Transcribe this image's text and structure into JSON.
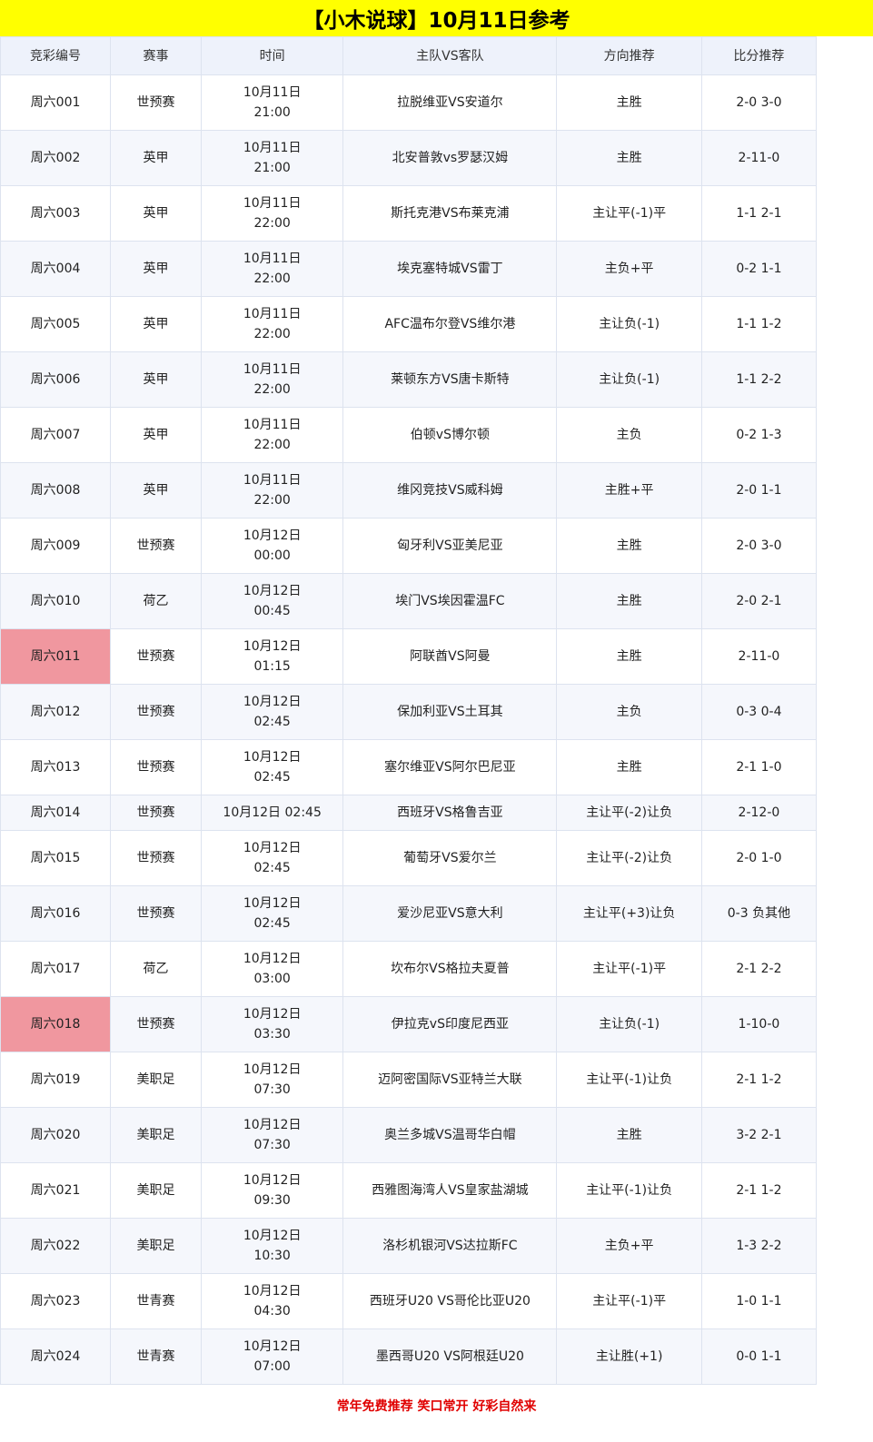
{
  "title": "【小木说球】10月11日参考",
  "columns": [
    "竞彩编号",
    "赛事",
    "时间",
    "主队VS客队",
    "方向推荐",
    "比分推荐"
  ],
  "rows": [
    {
      "id": "周六001",
      "league": "世预赛",
      "date": "10月11日",
      "time": "21:00",
      "match": "拉脱维亚VS安道尔",
      "pick": "主胜",
      "score": "2-0 3-0"
    },
    {
      "id": "周六002",
      "league": "英甲",
      "date": "10月11日",
      "time": "21:00",
      "match": "北安普敦vs罗瑟汉姆",
      "pick": "主胜",
      "score": "2-11-0"
    },
    {
      "id": "周六003",
      "league": "英甲",
      "date": "10月11日",
      "time": "22:00",
      "match": "斯托克港VS布莱克浦",
      "pick": "主让平(-1)平",
      "score": "1-1 2-1"
    },
    {
      "id": "周六004",
      "league": "英甲",
      "date": "10月11日",
      "time": "22:00",
      "match": "埃克塞特城VS雷丁",
      "pick": "主负+平",
      "score": "0-2 1-1"
    },
    {
      "id": "周六005",
      "league": "英甲",
      "date": "10月11日",
      "time": "22:00",
      "match": "AFC温布尔登VS维尔港",
      "pick": "主让负(-1)",
      "score": "1-1 1-2"
    },
    {
      "id": "周六006",
      "league": "英甲",
      "date": "10月11日",
      "time": "22:00",
      "match": "莱顿东方VS唐卡斯特",
      "pick": "主让负(-1)",
      "score": "1-1 2-2"
    },
    {
      "id": "周六007",
      "league": "英甲",
      "date": "10月11日",
      "time": "22:00",
      "match": "伯顿vS博尔顿",
      "pick": "主负",
      "score": "0-2 1-3"
    },
    {
      "id": "周六008",
      "league": "英甲",
      "date": "10月11日",
      "time": "22:00",
      "match": "维冈竞技VS威科姆",
      "pick": "主胜+平",
      "score": "2-0 1-1"
    },
    {
      "id": "周六009",
      "league": "世预赛",
      "date": "10月12日",
      "time": "00:00",
      "match": "匈牙利VS亚美尼亚",
      "pick": "主胜",
      "score": "2-0 3-0"
    },
    {
      "id": "周六010",
      "league": "荷乙",
      "date": "10月12日",
      "time": "00:45",
      "match": "埃门VS埃因霍温FC",
      "pick": "主胜",
      "score": "2-0 2-1"
    },
    {
      "id": "周六011",
      "league": "世预赛",
      "date": "10月12日",
      "time": "01:15",
      "match": "阿联酋VS阿曼",
      "pick": "主胜",
      "score": "2-11-0",
      "highlight": true
    },
    {
      "id": "周六012",
      "league": "世预赛",
      "date": "10月12日",
      "time": "02:45",
      "match": "保加利亚VS土耳其",
      "pick": "主负",
      "score": "0-3 0-4"
    },
    {
      "id": "周六013",
      "league": "世预赛",
      "date": "10月12日",
      "time": "02:45",
      "match": "塞尔维亚VS阿尔巴尼亚",
      "pick": "主胜",
      "score": "2-1 1-0"
    },
    {
      "id": "周六014",
      "league": "世预赛",
      "date": "10月12日 02:45",
      "time": "",
      "match": "西班牙VS格鲁吉亚",
      "pick": "主让平(-2)让负",
      "score": "2-12-0",
      "single": true
    },
    {
      "id": "周六015",
      "league": "世预赛",
      "date": "10月12日",
      "time": "02:45",
      "match": "葡萄牙VS爱尔兰",
      "pick": "主让平(-2)让负",
      "score": "2-0 1-0"
    },
    {
      "id": "周六016",
      "league": "世预赛",
      "date": "10月12日",
      "time": "02:45",
      "match": "爱沙尼亚VS意大利",
      "pick": "主让平(+3)让负",
      "score": "0-3 负其他"
    },
    {
      "id": "周六017",
      "league": "荷乙",
      "date": "10月12日",
      "time": "03:00",
      "match": "坎布尔VS格拉夫夏普",
      "pick": "主让平(-1)平",
      "score": "2-1 2-2"
    },
    {
      "id": "周六018",
      "league": "世预赛",
      "date": "10月12日",
      "time": "03:30",
      "match": "伊拉克vS印度尼西亚",
      "pick": "主让负(-1)",
      "score": "1-10-0",
      "highlight": true
    },
    {
      "id": "周六019",
      "league": "美职足",
      "date": "10月12日",
      "time": "07:30",
      "match": "迈阿密国际VS亚特兰大联",
      "pick": "主让平(-1)让负",
      "score": "2-1 1-2"
    },
    {
      "id": "周六020",
      "league": "美职足",
      "date": "10月12日",
      "time": "07:30",
      "match": "奥兰多城VS温哥华白帽",
      "pick": "主胜",
      "score": "3-2 2-1"
    },
    {
      "id": "周六021",
      "league": "美职足",
      "date": "10月12日",
      "time": "09:30",
      "match": "西雅图海湾人VS皇家盐湖城",
      "pick": "主让平(-1)让负",
      "score": "2-1 1-2"
    },
    {
      "id": "周六022",
      "league": "美职足",
      "date": "10月12日",
      "time": "10:30",
      "match": "洛杉机银河VS达拉斯FC",
      "pick": "主负+平",
      "score": "1-3 2-2"
    },
    {
      "id": "周六023",
      "league": "世青赛",
      "date": "10月12日",
      "time": "04:30",
      "match": "西班牙U20 VS哥伦比亚U20",
      "pick": "主让平(-1)平",
      "score": "1-0 1-1"
    },
    {
      "id": "周六024",
      "league": "世青赛",
      "date": "10月12日",
      "time": "07:00",
      "match": "墨西哥U20 VS阿根廷U20",
      "pick": "主让胜(+1)",
      "score": "0-0 1-1"
    }
  ],
  "footer": "常年免费推荐 笑口常开 好彩自然来",
  "colors": {
    "title_bg": "#ffff00",
    "highlight": "#f0979f",
    "footer_text": "#e00000"
  }
}
